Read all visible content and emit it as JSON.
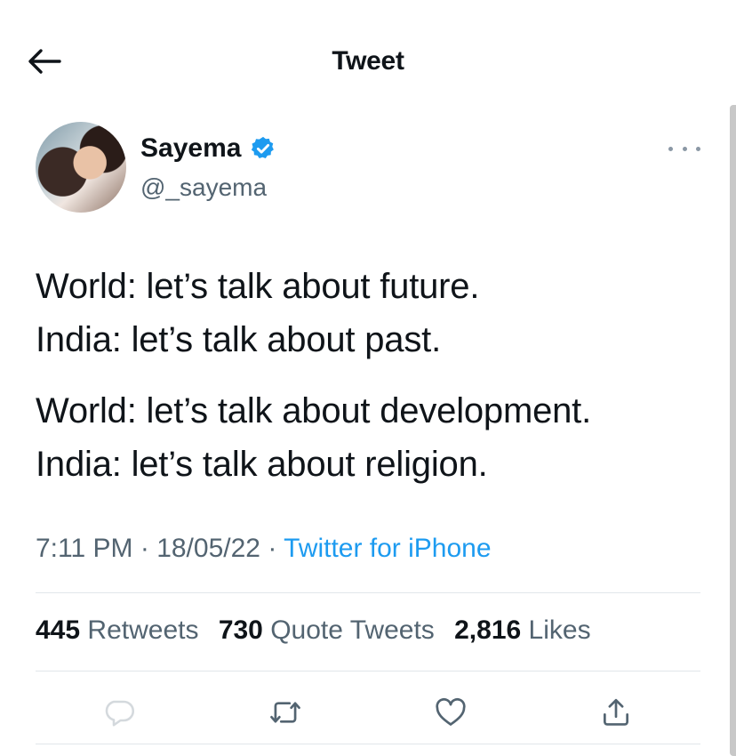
{
  "header": {
    "title": "Tweet"
  },
  "author": {
    "name": "Sayema",
    "handle": "@_sayema"
  },
  "tweet": {
    "paragraphs": [
      {
        "line1": "World: let’s talk about future.",
        "line2": "India: let’s talk about past."
      },
      {
        "line1": "World: let’s talk about development.",
        "line2": "India: let’s talk about religion."
      }
    ],
    "time": "7:11 PM",
    "date": "18/05/22",
    "separator": "·",
    "source": "Twitter for iPhone"
  },
  "stats": {
    "retweets_count": "445",
    "retweets_label": "Retweets",
    "quotes_count": "730",
    "quotes_label": "Quote Tweets",
    "likes_count": "2,816",
    "likes_label": "Likes"
  },
  "icons": {
    "back": "arrow-left-icon",
    "verified": "verified-badge-icon",
    "more": "more-horizontal-icon",
    "reply": "reply-icon",
    "retweet": "retweet-icon",
    "like": "heart-icon",
    "share": "share-icon"
  },
  "colors": {
    "accent": "#1d9bf0",
    "text": "#0f1419",
    "secondary": "#536471",
    "divider": "#e1e6ea"
  }
}
